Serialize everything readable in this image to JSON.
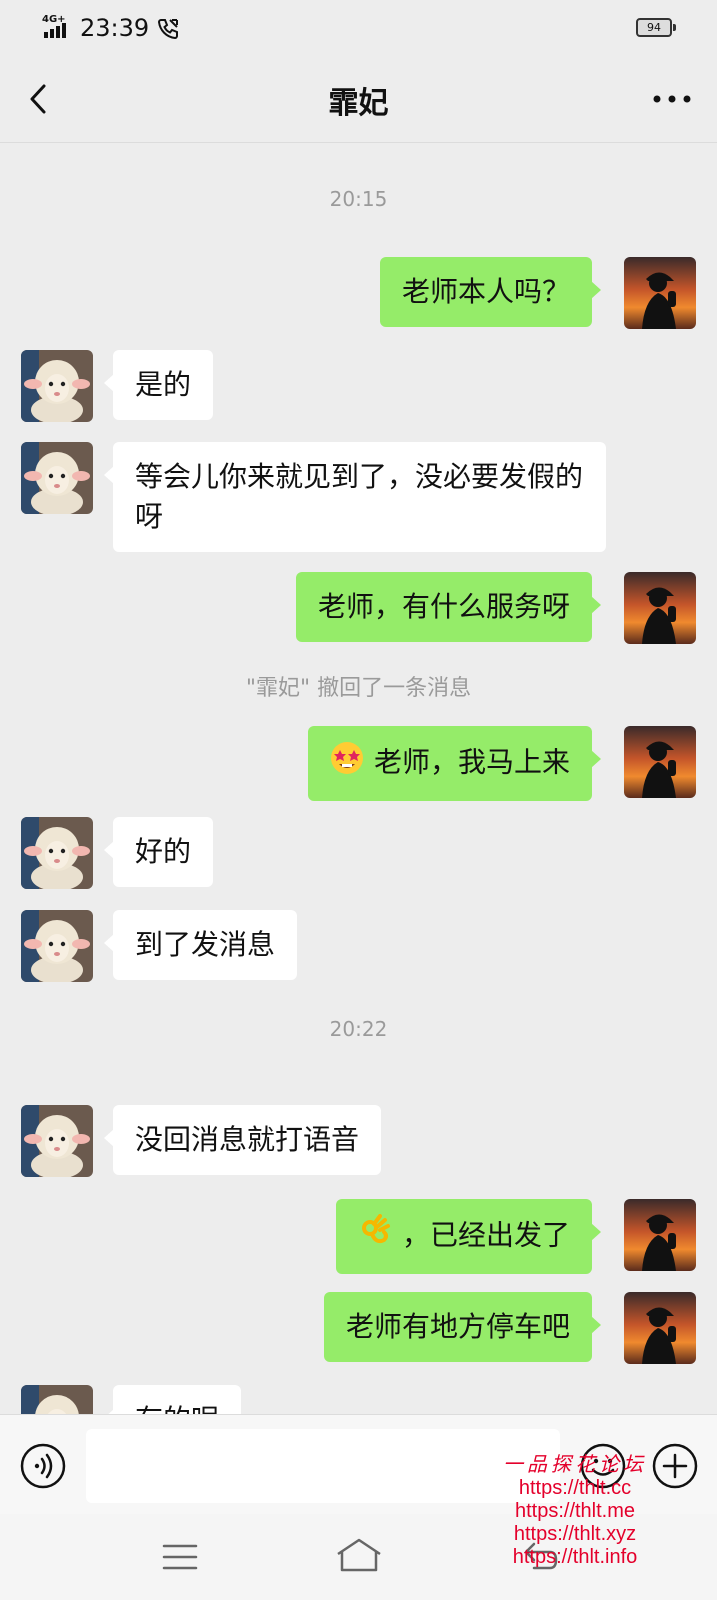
{
  "status_bar": {
    "network": "4G+",
    "time": "23:39",
    "battery": "94"
  },
  "header": {
    "title": "霏妃"
  },
  "messages": [
    {
      "type": "time",
      "text": "20:15"
    },
    {
      "type": "out",
      "text": "老师本人吗？"
    },
    {
      "type": "in",
      "text": "是的"
    },
    {
      "type": "in",
      "text": "等会儿你来就见到了，没必要发假的呀"
    },
    {
      "type": "out",
      "text": "老师，有什么服务呀"
    },
    {
      "type": "system",
      "text": "\"霏妃\" 撤回了一条消息"
    },
    {
      "type": "out",
      "emoji": "star-struck-emoji",
      "text": "老师，我马上来"
    },
    {
      "type": "in",
      "text": "好的"
    },
    {
      "type": "in",
      "text": "到了发消息"
    },
    {
      "type": "time",
      "text": "20:22"
    },
    {
      "type": "in",
      "text": "没回消息就打语音"
    },
    {
      "type": "out",
      "emoji": "ok-hand-emoji",
      "text": "，已经出发了"
    },
    {
      "type": "out",
      "text": "老师有地方停车吧"
    },
    {
      "type": "in",
      "text": "有的呢"
    }
  ],
  "input": {
    "placeholder": ""
  },
  "watermark": {
    "title": "一品探花论坛",
    "urls": [
      "https://thlt.cc",
      "https://thlt.me",
      "https://thlt.xyz",
      "https://thlt.info"
    ]
  },
  "colors": {
    "background": "#ededed",
    "outgoing_bubble": "#95ec69",
    "incoming_bubble": "#ffffff",
    "watermark": "#e4002b"
  }
}
